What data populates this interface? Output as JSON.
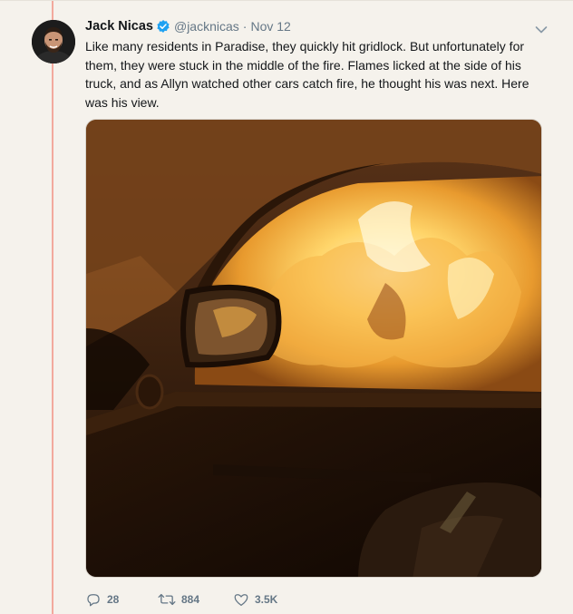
{
  "tweet": {
    "author_name": "Jack Nicas",
    "handle": "@jacknicas",
    "separator": "·",
    "date": "Nov 12",
    "text": "Like many residents in Paradise, they quickly hit gridlock. But unfortunately for them, they were stuck in the middle of the fire. Flames licked at the side of his truck, and as Allyn watched other cars catch fire, he thought his was next. Here was his view."
  },
  "actions": {
    "replies": "28",
    "retweets": "884",
    "likes": "3.5K"
  },
  "icons": {
    "verified": "verified-badge-icon",
    "menu": "chevron-down-icon",
    "reply": "reply-icon",
    "retweet": "retweet-icon",
    "like": "heart-icon"
  },
  "colors": {
    "thread_line": "#f2a99d",
    "verified": "#1da1f2",
    "secondary_text": "#657786",
    "primary_text": "#14171a"
  }
}
